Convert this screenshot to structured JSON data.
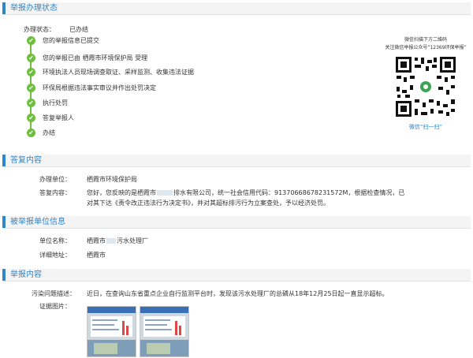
{
  "sections": {
    "status": "举报办理状态",
    "reply": "答复内容",
    "target": "被举报单位信息",
    "content": "举报内容"
  },
  "status": {
    "label": "办理状态：",
    "value": "已办结",
    "steps": [
      "您的举报信息已提交",
      "您的举报已由 栖霞市环境保护局 受理",
      "环境执法人员现场调查取证、采样监测、收集违法证据",
      "环保局根据违法事实审议并作出处罚决定",
      "执行处罚",
      "答复举报人",
      "办结"
    ],
    "check_color": "#6fbe3f"
  },
  "qr": {
    "caption1": "微信扫描下方二维码",
    "caption2": "关注微信举报公众号“12369环保举报”",
    "caption3": "微信“扫一扫”"
  },
  "reply": {
    "unit_label": "办理单位：",
    "unit_value": "栖霞市环境保护局",
    "content_label": "答复内容：",
    "line1_a": "您好，您反映的是栖霞市",
    "line1_b": "排水有限公司，统一社会信用代码：913706686782315​72M，根据检查情况，已",
    "line2": "对其下达《责令改正违法行为决定书》，并对其超标排污行为立案查处，予以经济处罚。"
  },
  "target": {
    "name_label": "单位名称：",
    "name_a": "栖霞市",
    "name_b": "污水处理厂",
    "addr_label": "详细地址：",
    "addr_value": "栖霞市"
  },
  "content": {
    "issue_label": "污染问题描述：",
    "issue_value": "近日，在查询山东省重点企业自行监测平台时，发现该污水处理厂的总磷从18年12月25日起一直显示超标。",
    "evidence_label": "证据图片："
  },
  "accent": "#2f86c9"
}
